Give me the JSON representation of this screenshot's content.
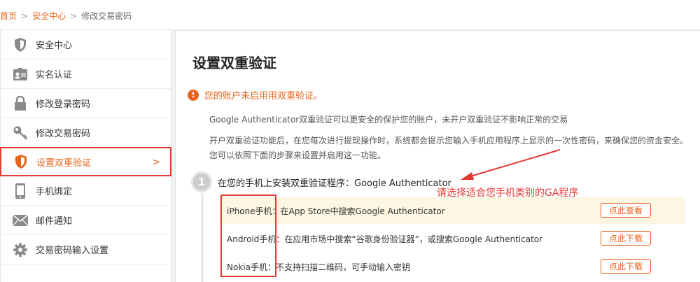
{
  "breadcrumb": {
    "home": "首页",
    "security": "安全中心",
    "current": "修改交易密码",
    "sep": ">"
  },
  "sidebar": {
    "items": [
      {
        "label": "安全中心",
        "icon": "shield-icon"
      },
      {
        "label": "实名认证",
        "icon": "id-card-icon"
      },
      {
        "label": "修改登录密码",
        "icon": "lock-icon"
      },
      {
        "label": "修改交易密码",
        "icon": "key-icon"
      },
      {
        "label": "设置双重验证",
        "icon": "shield-check-icon",
        "active": true,
        "chevron": ">"
      },
      {
        "label": "手机绑定",
        "icon": "phone-icon"
      },
      {
        "label": "邮件通知",
        "icon": "mail-icon"
      },
      {
        "label": "交易密码输入设置",
        "icon": "gear-icon"
      }
    ]
  },
  "main": {
    "title": "设置双重验证",
    "warning": "您的账户未启用用双重验证。",
    "desc1": "Google Authenticator双重验证可以更安全的保护您的账户，未开户双重验证不影响正常的交易",
    "desc2": "开户双重验证功能后，在您每次进行提现操作时，系统都会提示您输入手机应用程序上显示的一次性密码，来确保您的资金安全。您可以依照下面的步骤来设置并启用这一功能。",
    "step": {
      "number": "1",
      "text": "在您的手机上安装双重验证程序：Google Authenticator"
    },
    "annotation": "请选择适合您手机类别的GA程序",
    "rows": [
      {
        "label": "iPhone手机：在App Store中搜索Google Authenticator",
        "button": "点此查看"
      },
      {
        "label": "Android手机：在应用市场中搜索“谷歌身份验证器”，或搜索Google Authenticator",
        "button": "点此下载"
      },
      {
        "label": "Nokia手机：不支持扫描二维码，可手动输入密钥",
        "button": "点此下载"
      }
    ]
  },
  "colors": {
    "accent": "#e8641b",
    "annotation": "#e53935"
  }
}
